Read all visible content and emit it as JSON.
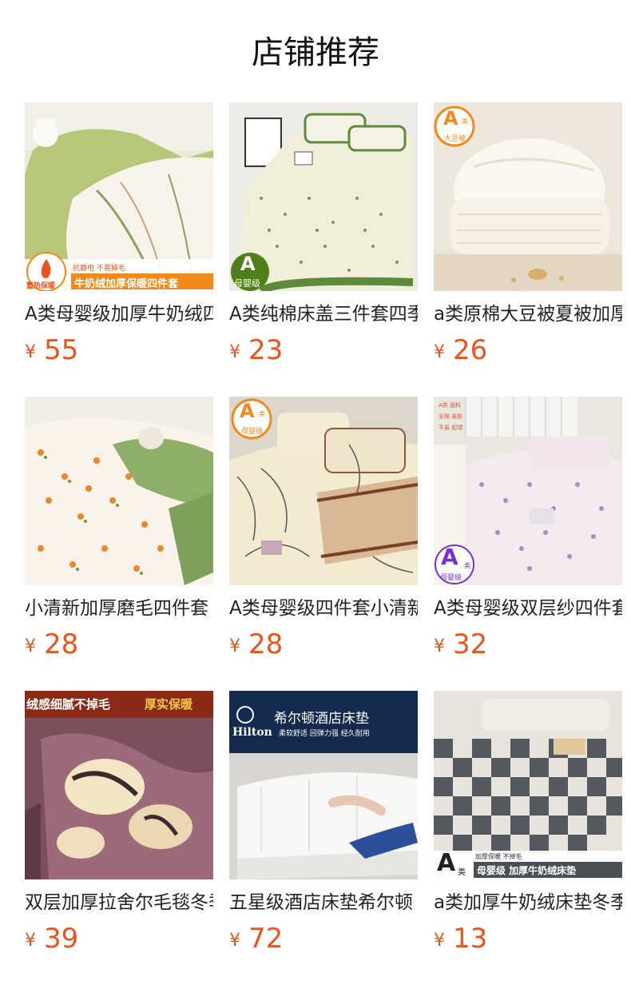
{
  "page_title": "店铺推荐",
  "currency": "¥",
  "products": [
    {
      "name": "A类母婴级加厚牛奶绒四件套",
      "price": "55",
      "badges": [
        "蓄热保暖",
        "抗静电 不易掉毛",
        "牛奶绒加厚保暖四件套"
      ]
    },
    {
      "name": "A类纯棉床盖三件套四季",
      "price": "23",
      "badges": [
        "A",
        "母婴级"
      ]
    },
    {
      "name": "a类原棉大豆被夏被加厚",
      "price": "26",
      "badges": [
        "A",
        "类",
        "大豆被"
      ]
    },
    {
      "name": "小清新加厚磨毛四件套",
      "price": "28",
      "badges": []
    },
    {
      "name": "A类母婴级四件套小清新",
      "price": "28",
      "badges": [
        "A",
        "类",
        "母婴级"
      ]
    },
    {
      "name": "A类母婴级双层纱四件套",
      "price": "32",
      "badges": [
        "A类 面料",
        "全棉 亲肤",
        "不易 起球",
        "A",
        "类",
        "母婴级"
      ]
    },
    {
      "name": "双层加厚拉舍尔毛毯冬季",
      "price": "39",
      "badges": [
        "绒感细腻不掉毛",
        "厚实保暖"
      ]
    },
    {
      "name": "五星级酒店床垫希尔顿",
      "price": "72",
      "badges": [
        "希尔顿酒店床垫",
        "Hilton",
        "柔软舒适 回弹力强 经久耐用"
      ]
    },
    {
      "name": "a类加厚牛奶绒床垫冬季",
      "price": "13",
      "badges": [
        "A",
        "类",
        "加厚保暖 不掉毛",
        "母婴级 加厚牛奶绒床垫"
      ]
    }
  ],
  "colors": {
    "price": "#e8551f",
    "badge_orange": "#f08a1c",
    "badge_purple": "#7a2fd0",
    "badge_green": "#4e7f1a"
  }
}
